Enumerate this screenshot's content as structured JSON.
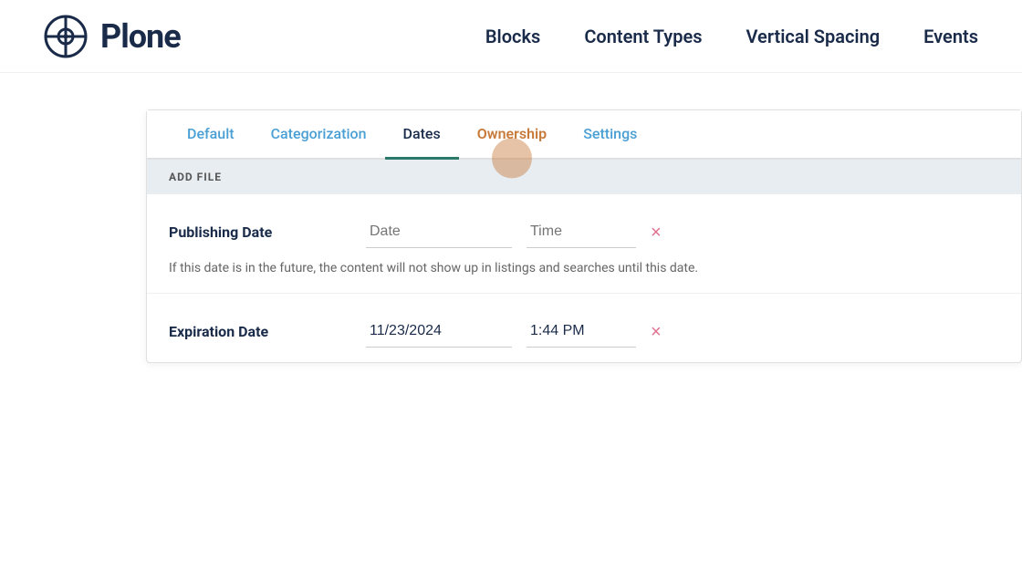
{
  "header": {
    "logo_text": "Plone",
    "logo_dot": "·",
    "nav_items": [
      {
        "label": "Blocks",
        "id": "blocks"
      },
      {
        "label": "Content Types",
        "id": "content-types"
      },
      {
        "label": "Vertical Spacing",
        "id": "vertical-spacing"
      },
      {
        "label": "Events",
        "id": "events"
      }
    ]
  },
  "tabs": [
    {
      "label": "Default",
      "id": "default",
      "state": "inactive"
    },
    {
      "label": "Categorization",
      "id": "categorization",
      "state": "inactive"
    },
    {
      "label": "Dates",
      "id": "dates",
      "state": "active"
    },
    {
      "label": "Ownership",
      "id": "ownership",
      "state": "highlighted"
    },
    {
      "label": "Settings",
      "id": "settings",
      "state": "inactive"
    }
  ],
  "section_label": "ADD FILE",
  "publishing_date": {
    "label": "Publishing Date",
    "date_placeholder": "Date",
    "time_placeholder": "Time",
    "date_value": "",
    "time_value": "",
    "clear_label": "×"
  },
  "publishing_help_text": "If this date is in the future, the content will not show up in listings and searches until this date.",
  "expiration_date": {
    "label": "Expiration Date",
    "date_value": "11/23/2024",
    "time_value": "1:44 PM",
    "clear_label": "×"
  }
}
